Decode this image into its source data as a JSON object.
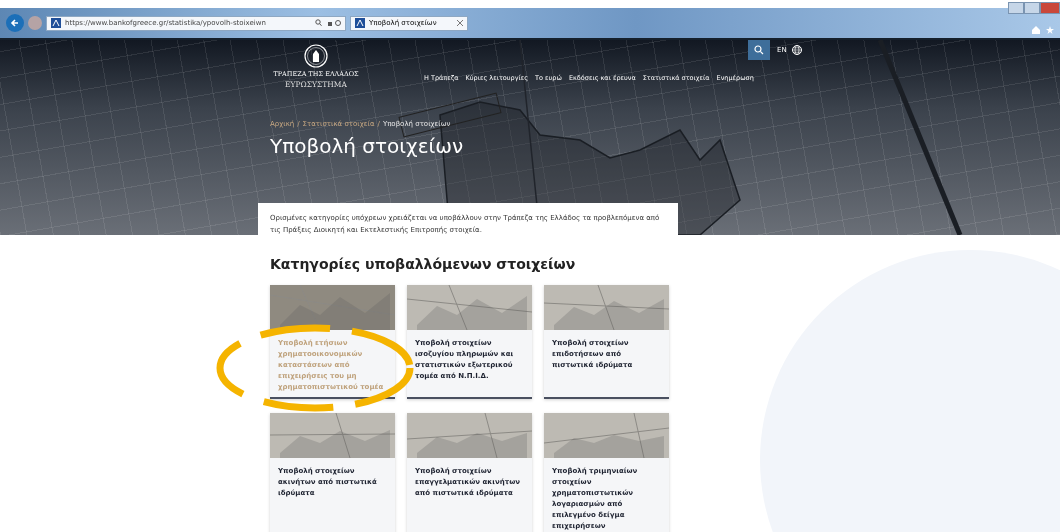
{
  "browser": {
    "url": "https://www.bankofgreece.gr/statistika/ypovolh-stoixeiwn",
    "tab_title": "Υποβολή στοιχείων"
  },
  "site": {
    "logo_name": "ΤΡΑΠΕΖΑ ΤΗΣ ΕΛΛΑΔΟΣ",
    "logo_sub": "ΕΥΡΩΣΥΣΤΗΜΑ",
    "nav": [
      "Η Τράπεζα",
      "Κύριες λειτουργίες",
      "Το ευρώ",
      "Εκδόσεις και έρευνα",
      "Στατιστικά στοιχεία",
      "Ενημέρωση"
    ],
    "language": "EN"
  },
  "breadcrumb_separator": "/",
  "breadcrumb": [
    "Αρχική",
    "Στατιστικά στοιχεία",
    "Υποβολή στοιχείων"
  ],
  "page_title": "Υποβολή στοιχείων",
  "intro": "Ορισμένες κατηγορίες υπόχρεων χρειάζεται να υποβάλλουν στην Τράπεζα της Ελλάδος τα προβλεπόμενα από τις Πράξεις Διοικητή και Εκτελεστικής Επιτροπής στοιχεία.",
  "section_title": "Κατηγορίες υποβαλλόμενων στοιχείων",
  "cards": [
    {
      "title": "Υποβολή ετήσιων χρηματοοικονομικών καταστάσεων από επιχειρήσεις του μη χρηματοπιστωτικού τομέα",
      "hovered": true
    },
    {
      "title": "Υποβολή στοιχείων ισοζυγίου πληρωμών και στατιστικών εξωτερικού τομέα από Ν.Π.Ι.Δ.",
      "hovered": false
    },
    {
      "title": "Υποβολή στοιχείων επιδοτήσεων από πιστωτικά ιδρύματα",
      "hovered": false
    },
    {
      "title": "Υποβολή στοιχείων ακινήτων από πιστωτικά ιδρύματα",
      "hovered": false
    },
    {
      "title": "Υποβολή στοιχείων επαγγελματικών ακινήτων από πιστωτικά ιδρύματα",
      "hovered": false
    },
    {
      "title": "Υποβολή τριμηνιαίων στοιχείων χρηματοπιστωτικών λογαριασμών από επιλεγμένο δείγμα επιχειρήσεων",
      "hovered": false
    }
  ]
}
